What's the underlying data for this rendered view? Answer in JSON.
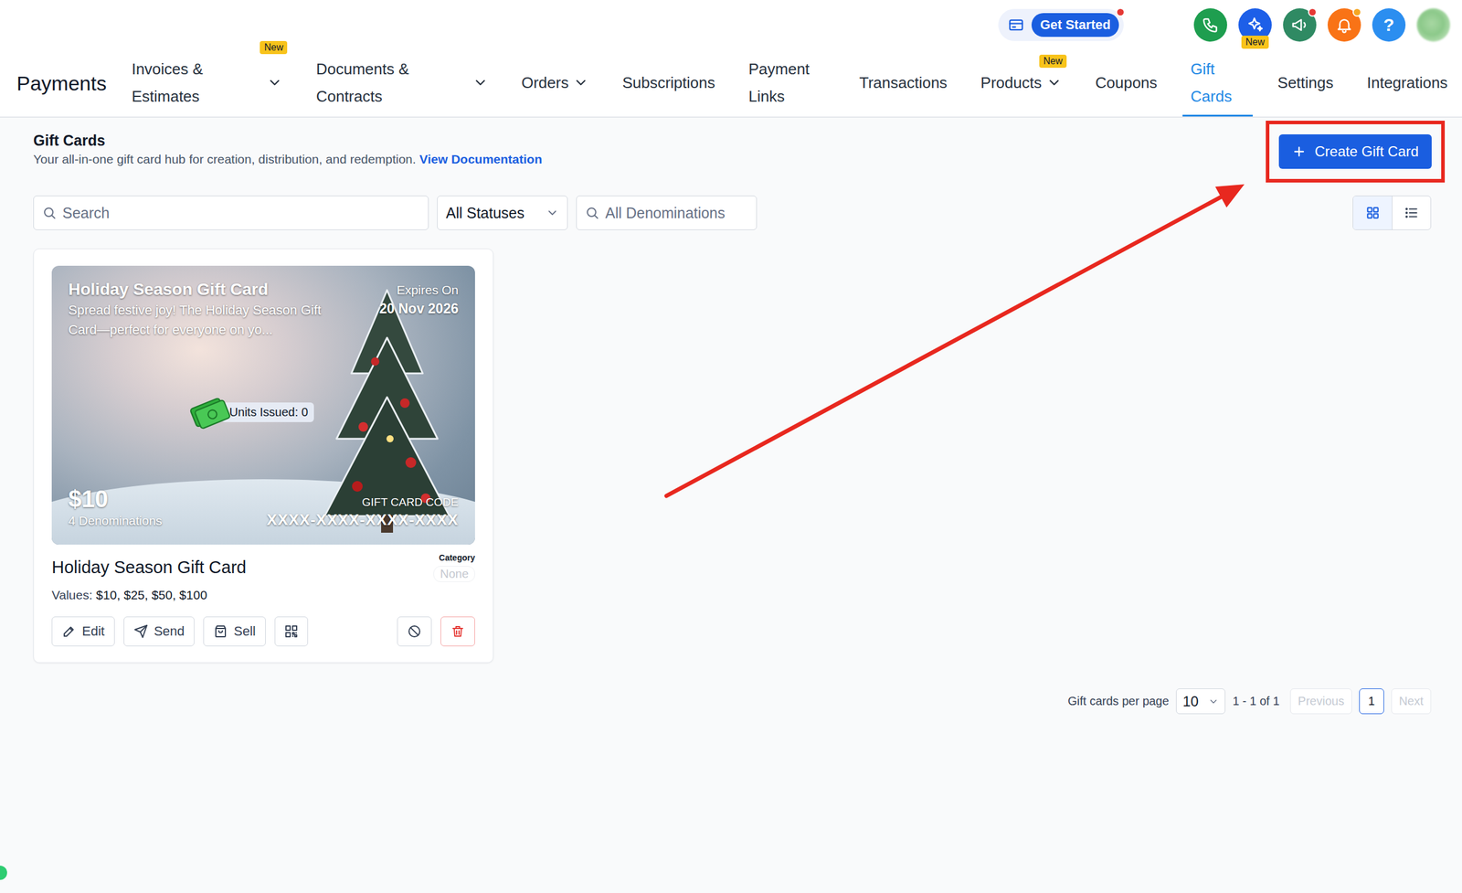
{
  "get_started": {
    "label": "Get Started",
    "dot": true
  },
  "top_icons": [
    {
      "kind": "phone",
      "color": "#1e9e4f",
      "dot": false
    },
    {
      "kind": "ai",
      "color": "#1d5fe8",
      "dot": false,
      "badge": "New"
    },
    {
      "kind": "announcement",
      "color": "#2f8a63",
      "dot": true,
      "dot_color": "#e53935"
    },
    {
      "kind": "notifications",
      "color": "#f97316",
      "dot": true,
      "dot_color": "#f5a623"
    },
    {
      "kind": "help",
      "color": "#2b8ef0",
      "dot": false,
      "text": "?"
    },
    {
      "kind": "avatar",
      "color": "#8cc98a",
      "dot": false
    }
  ],
  "nav": {
    "title": "Payments",
    "items": [
      {
        "label": "Invoices & Estimates",
        "dropdown": true,
        "badge": "New",
        "selected": false
      },
      {
        "label": "Documents & Contracts",
        "dropdown": true,
        "selected": false
      },
      {
        "label": "Orders",
        "dropdown": true,
        "selected": false
      },
      {
        "label": "Subscriptions",
        "dropdown": false,
        "selected": false
      },
      {
        "label": "Payment Links",
        "dropdown": false,
        "selected": false
      },
      {
        "label": "Transactions",
        "dropdown": false,
        "selected": false
      },
      {
        "label": "Products",
        "dropdown": true,
        "badge": "New",
        "selected": false
      },
      {
        "label": "Coupons",
        "dropdown": false,
        "selected": false
      },
      {
        "label": "Gift Cards",
        "dropdown": false,
        "selected": true
      },
      {
        "label": "Settings",
        "dropdown": false,
        "selected": false
      },
      {
        "label": "Integrations",
        "dropdown": false,
        "selected": false
      }
    ]
  },
  "page": {
    "title": "Gift Cards",
    "description": "Your all-in-one gift card hub for creation, distribution, and redemption.",
    "doc_link": "View Documentation",
    "create_button": "Create Gift Card"
  },
  "filters": {
    "search_placeholder": "Search",
    "status": "All Statuses",
    "denominations_placeholder": "All Denominations",
    "views": [
      {
        "kind": "grid",
        "selected": true
      },
      {
        "kind": "list",
        "selected": false
      }
    ]
  },
  "cards": [
    {
      "image_title": "Holiday Season Gift Card",
      "image_description": "Spread festive joy! The Holiday Season Gift Card—perfect for everyone on yo...",
      "expires_label": "Expires On",
      "expires_date": "20 Nov 2026",
      "units_issued": "Units Issued: 0",
      "amount": "$10",
      "denominations": "4 Denominations",
      "code_label": "GIFT CARD CODE",
      "code": "XXXX-XXXX-XXXX-XXXX",
      "title": "Holiday Season Gift Card",
      "category_label": "Category",
      "category": "None",
      "values_label": "Values:",
      "values": "$10, $25, $50, $100",
      "actions": [
        {
          "kind": "edit",
          "label": "Edit"
        },
        {
          "kind": "send",
          "label": "Send"
        },
        {
          "kind": "sell",
          "label": "Sell"
        },
        {
          "kind": "qr"
        },
        {
          "kind": "disable"
        },
        {
          "kind": "delete"
        }
      ]
    }
  ],
  "pagination": {
    "label": "Gift cards per page",
    "per_page": "10",
    "range": "1 - 1 of 1",
    "previous": {
      "label": "Previous",
      "disabled": true
    },
    "pages": [
      {
        "label": "1",
        "selected": true
      }
    ],
    "next": {
      "label": "Next",
      "disabled": true
    }
  }
}
